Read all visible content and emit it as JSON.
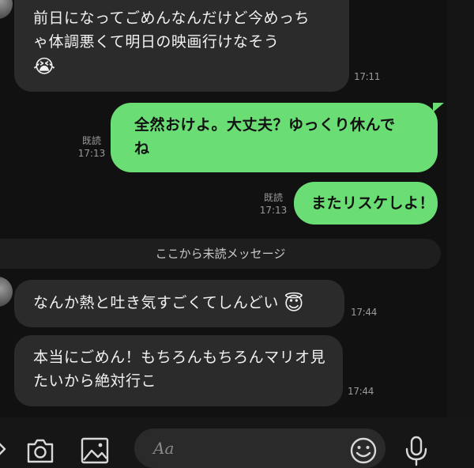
{
  "messages": [
    {
      "lines": [
        "前日になってごめんなんだけど今めっち",
        "ゃ体調悪くて明日の映画行けなそう"
      ],
      "emoji": "😭",
      "emoji_name": "loudly-crying-face-emoji",
      "time": "17:11"
    },
    {
      "lines": [
        "全然おけよ。大丈夫？ゆっくり休んで",
        "ね"
      ],
      "read": "既読",
      "time": "17:13"
    },
    {
      "lines": [
        "またリスケしよ！"
      ],
      "read": "既読",
      "time": "17:13"
    },
    {
      "lines": [
        "なんか熱と吐き気すごくてしんどい"
      ],
      "emoji": "😇",
      "emoji_name": "smiling-face-with-halo-emoji",
      "time": "17:44"
    },
    {
      "lines": [
        "本当にごめん！もちろんもちろんマリオ見",
        "たいから絶対行こ"
      ],
      "time": "17:44"
    }
  ],
  "divider": {
    "label": "ここから未読メッセージ"
  },
  "input": {
    "placeholder": "Aa"
  },
  "icons": {
    "camera": "camera-icon",
    "image": "image-icon",
    "emoji": "emoji-icon",
    "mic": "microphone-icon",
    "menu": "chevron-icon"
  },
  "colors": {
    "background": "#111111",
    "received_bubble": "#2b2b2b",
    "sent_bubble": "#6ade74",
    "meta_text": "#9a9a9a"
  }
}
